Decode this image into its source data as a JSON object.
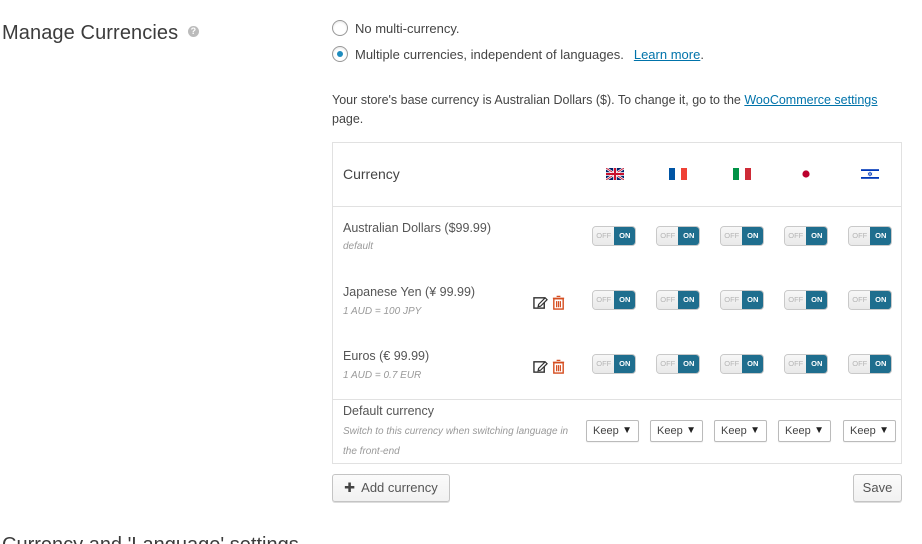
{
  "section": {
    "title": "Manage Currencies",
    "help_icon": "?"
  },
  "options": [
    {
      "label": "No multi-currency.",
      "checked": false
    },
    {
      "label": "Multiple currencies, independent of languages.",
      "checked": true,
      "link": "Learn more"
    }
  ],
  "base_note": {
    "text": "Your store's base currency is Australian Dollars ($). To change it, go to the",
    "link": "WooCommerce settings",
    "suffix": "page."
  },
  "table": {
    "header": "Currency",
    "languages": [
      "English",
      "French",
      "Italian",
      "Japanese",
      "Hebrew"
    ],
    "rows": [
      {
        "name": "Australian Dollars ($99.99)",
        "sub": "default",
        "editable": false
      },
      {
        "name": "Japanese Yen (¥ 99.99)",
        "sub": "1 AUD = 100 JPY",
        "editable": true
      },
      {
        "name": "Euros (€ 99.99)",
        "sub": "1 AUD = 0.7 EUR",
        "editable": true
      }
    ],
    "toggle": {
      "off": "OFF",
      "on": "ON"
    },
    "default_row": {
      "title": "Default currency",
      "help": "Switch to this currency when switching language in the front-end",
      "select_value": "Keep",
      "caret": "▼"
    }
  },
  "buttons": {
    "add_currency": "Add currency",
    "save": "Save"
  },
  "next_section_partial": "Currency and 'Language' settings",
  "colors": {
    "link": "#0073aa",
    "toggle_on": "#1f6e8e",
    "radio_dot": "#1e8cbe",
    "trash": "#d54e21"
  }
}
